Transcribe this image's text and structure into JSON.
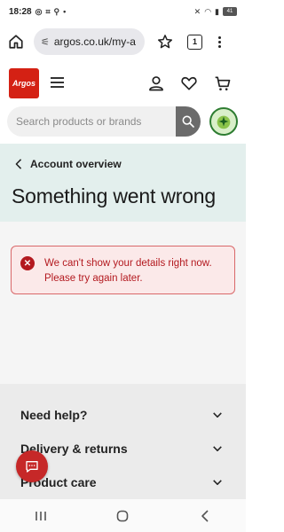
{
  "statusbar": {
    "time": "18:28",
    "battery": "41"
  },
  "browser": {
    "url": "argos.co.uk/my-a",
    "tab_count": "1"
  },
  "header": {
    "logo_text": "Argos"
  },
  "search": {
    "placeholder": "Search products or brands"
  },
  "page": {
    "back_label": "Account overview",
    "title": "Something went wrong"
  },
  "alert": {
    "message_line1": "We can't show your details right now.",
    "message_line2": "Please try again later."
  },
  "footer": {
    "items": [
      {
        "label": "Need help?"
      },
      {
        "label": "Delivery & returns"
      },
      {
        "label": "Product care"
      }
    ]
  },
  "colors": {
    "brand_red": "#d42114",
    "error_red": "#b3191f",
    "title_band": "#e3efed"
  }
}
